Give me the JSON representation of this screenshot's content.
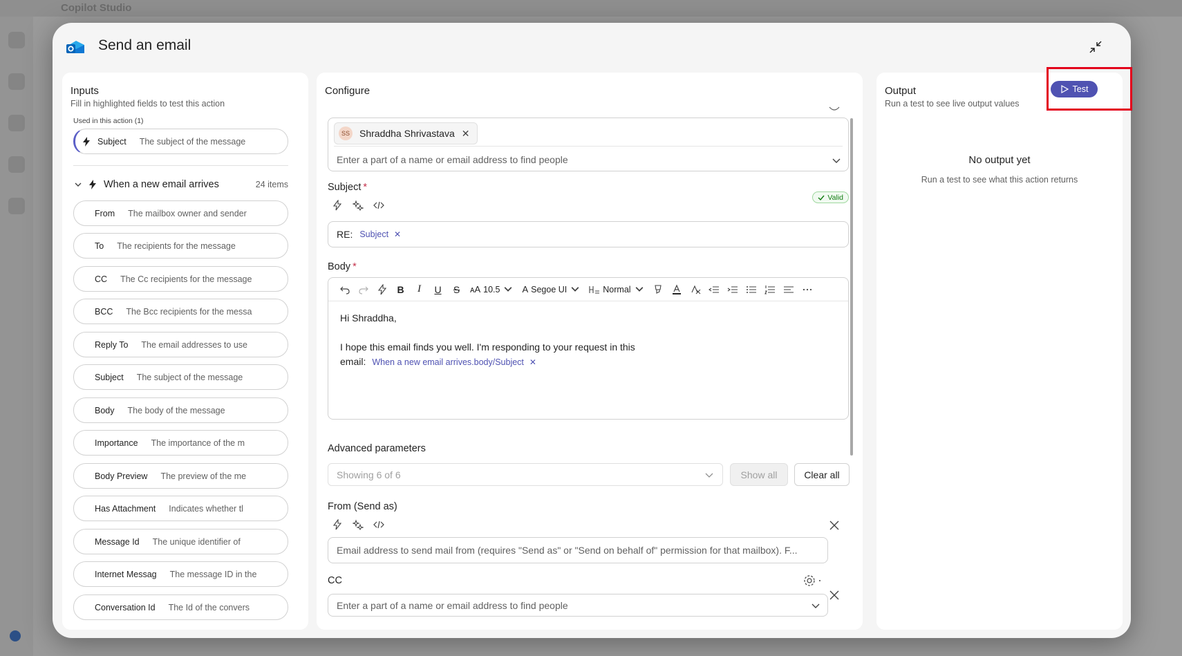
{
  "background": {
    "app_title": "Copilot Studio"
  },
  "modal": {
    "title": "Send an email"
  },
  "inputs": {
    "heading": "Inputs",
    "subheading": "Fill in highlighted fields to test this action",
    "used_label": "Used in this action (1)",
    "used_field": {
      "name": "Subject",
      "desc": "The subject of the message"
    },
    "group": {
      "name": "When a new email arrives",
      "count": "24 items"
    },
    "fields": [
      {
        "name": "From",
        "desc": "The mailbox owner and sender"
      },
      {
        "name": "To",
        "desc": "The recipients for the message"
      },
      {
        "name": "CC",
        "desc": "The Cc recipients for the message"
      },
      {
        "name": "BCC",
        "desc": "The Bcc recipients for the messa"
      },
      {
        "name": "Reply To",
        "desc": "The email addresses to use"
      },
      {
        "name": "Subject",
        "desc": "The subject of the message"
      },
      {
        "name": "Body",
        "desc": "The body of the message"
      },
      {
        "name": "Importance",
        "desc": "The importance of the m"
      },
      {
        "name": "Body Preview",
        "desc": "The preview of the me"
      },
      {
        "name": "Has Attachment",
        "desc": "Indicates whether tl"
      },
      {
        "name": "Message Id",
        "desc": "The unique identifier of"
      },
      {
        "name": "Internet Messag",
        "desc": "The message ID in the"
      },
      {
        "name": "Conversation Id",
        "desc": "The Id of the convers"
      }
    ]
  },
  "configure": {
    "heading": "Configure",
    "to": {
      "chip_initials": "SS",
      "chip_name": "Shraddha Shrivastava",
      "placeholder": "Enter a part of a name or email address to find people"
    },
    "subject": {
      "label": "Subject",
      "required_mark": "*",
      "valid_label": "Valid",
      "prefix": "RE:",
      "token": "Subject"
    },
    "body": {
      "label": "Body",
      "required_mark": "*",
      "font_size": "10.5",
      "font_name": "Segoe UI",
      "paragraph_style": "Normal",
      "line1": "Hi Shraddha,",
      "line2": "I hope this email finds you well. I'm responding to your request in this",
      "line3_prefix": "email:",
      "token": "When a new email arrives.body/Subject"
    },
    "advanced": {
      "label": "Advanced parameters",
      "showing": "Showing 6 of 6",
      "show_all": "Show all",
      "clear_all": "Clear all"
    },
    "from": {
      "label": "From (Send as)",
      "placeholder": "Email address to send mail from (requires \"Send as\" or \"Send on behalf of\" permission for that mailbox). F..."
    },
    "cc": {
      "label": "CC",
      "placeholder": "Enter a part of a name or email address to find people"
    }
  },
  "output": {
    "heading": "Output",
    "subheading": "Run a test to see live output values",
    "test_label": "Test",
    "empty_title": "No output yet",
    "empty_sub": "Run a test to see what this action returns"
  },
  "colors": {
    "accent": "#4f52b2",
    "highlight": "#e3001b",
    "valid": "#107c10"
  }
}
